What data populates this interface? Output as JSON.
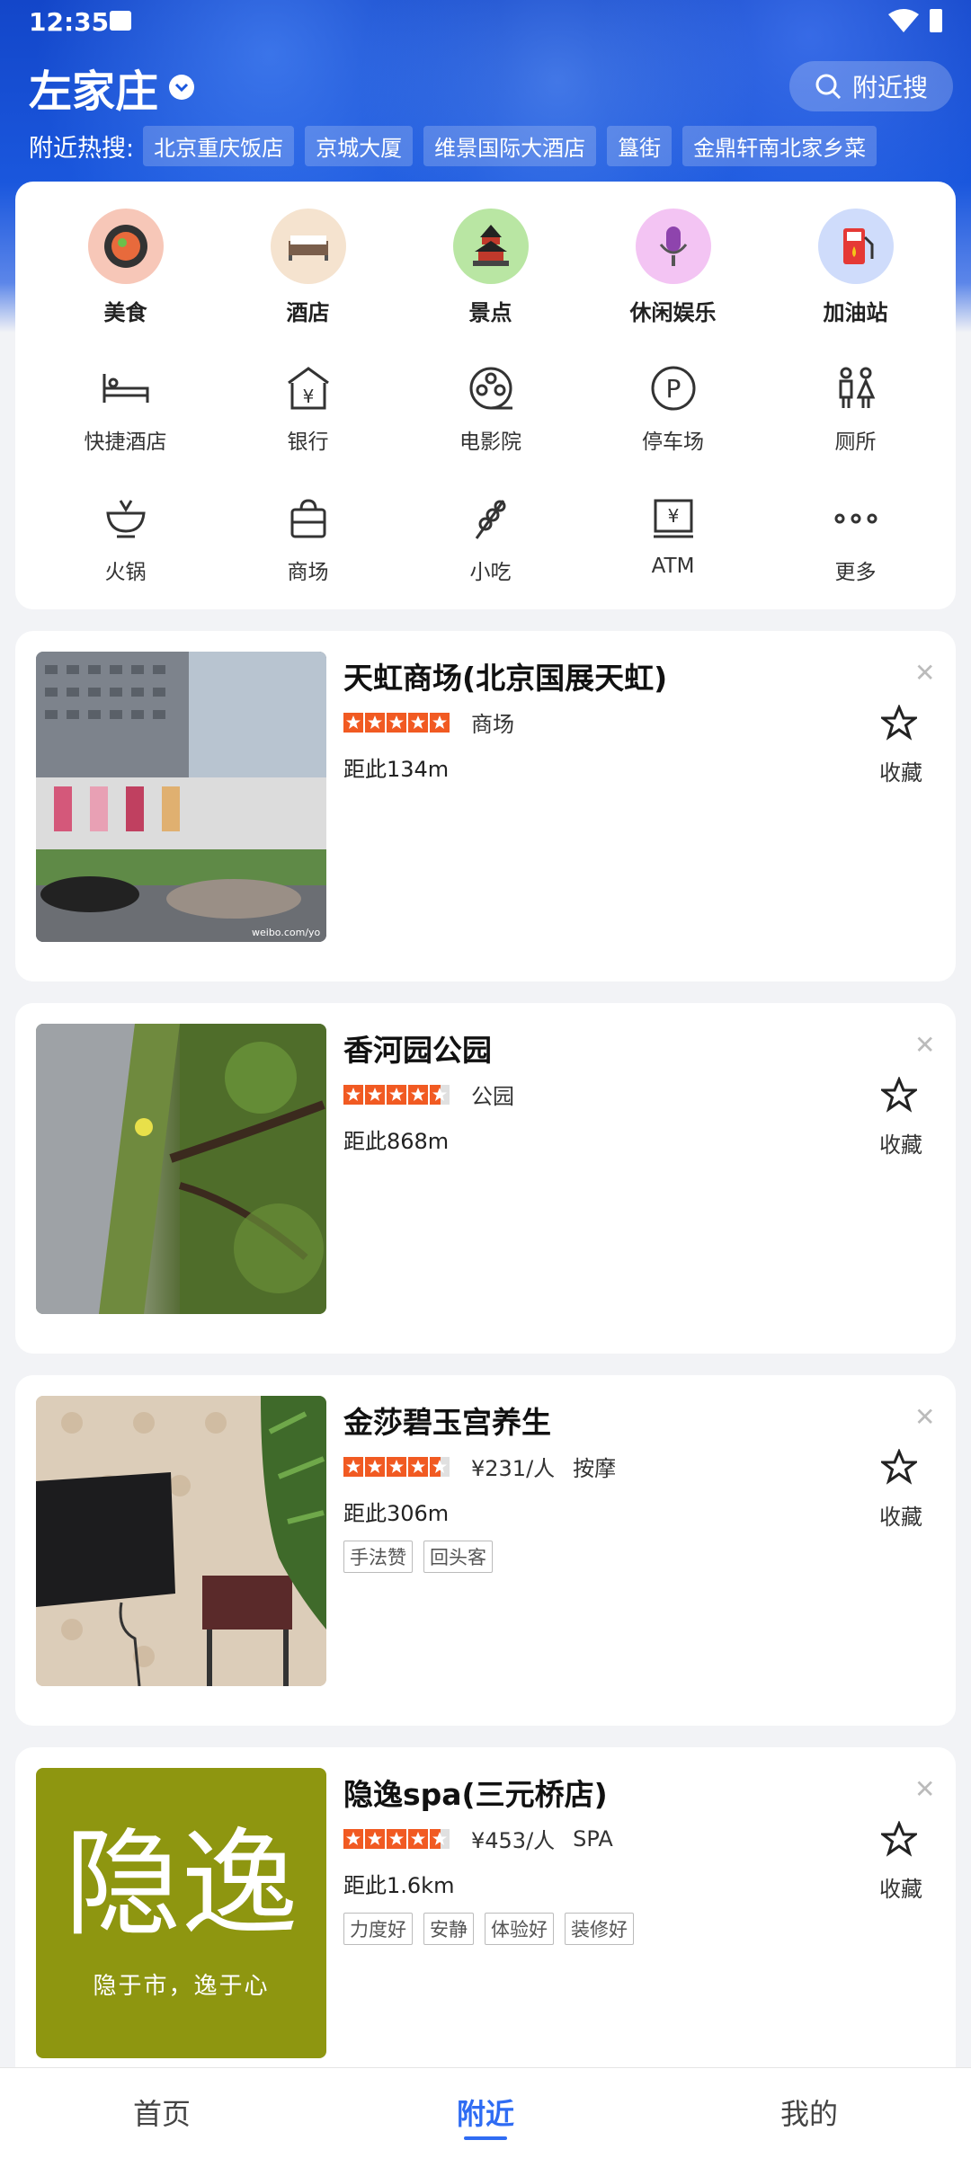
{
  "status_bar": {
    "time": "12:35"
  },
  "header": {
    "location": "左家庄",
    "nearby_search_label": "附近搜",
    "hot_search_label": "附近热搜:",
    "hot_search_items": [
      "北京重庆饭店",
      "京城大厦",
      "维景国际大酒店",
      "簋街",
      "金鼎轩南北家乡菜"
    ]
  },
  "categories_primary": [
    {
      "label": "美食",
      "icon": "food-icon"
    },
    {
      "label": "酒店",
      "icon": "hotel-icon"
    },
    {
      "label": "景点",
      "icon": "scenic-icon"
    },
    {
      "label": "休闲娱乐",
      "icon": "entertainment-icon"
    },
    {
      "label": "加油站",
      "icon": "gas-station-icon"
    }
  ],
  "categories_secondary": [
    {
      "label": "快捷酒店",
      "icon": "budget-hotel-icon"
    },
    {
      "label": "银行",
      "icon": "bank-icon"
    },
    {
      "label": "电影院",
      "icon": "cinema-icon"
    },
    {
      "label": "停车场",
      "icon": "parking-icon"
    },
    {
      "label": "厕所",
      "icon": "restroom-icon"
    },
    {
      "label": "火锅",
      "icon": "hotpot-icon"
    },
    {
      "label": "商场",
      "icon": "mall-icon"
    },
    {
      "label": "小吃",
      "icon": "snack-icon"
    },
    {
      "label": "ATM",
      "icon": "atm-icon"
    },
    {
      "label": "更多",
      "icon": "more-icon"
    }
  ],
  "pois": [
    {
      "name": "天虹商场(北京国展天虹)",
      "rating": 5,
      "price": "",
      "category": "商场",
      "distance": "距此134m",
      "tags": [],
      "fav_label": "收藏"
    },
    {
      "name": "香河园公园",
      "rating": 4.5,
      "price": "",
      "category": "公园",
      "distance": "距此868m",
      "tags": [],
      "fav_label": "收藏"
    },
    {
      "name": "金莎碧玉宫养生",
      "rating": 4.5,
      "price": "¥231/人",
      "category": "按摩",
      "distance": "距此306m",
      "tags": [
        "手法赞",
        "回头客"
      ],
      "fav_label": "收藏"
    },
    {
      "name": "隐逸spa(三元桥店)",
      "rating": 4.5,
      "price": "¥453/人",
      "category": "SPA",
      "distance": "距此1.6km",
      "tags": [
        "力度好",
        "安静",
        "体验好",
        "装修好"
      ],
      "fav_label": "收藏",
      "logo_text": "隐逸",
      "logo_slogan": "隐于市，逸于心"
    }
  ],
  "image_watermark": "weibo.com/yo",
  "bottom_nav": [
    {
      "label": "首页",
      "active": false
    },
    {
      "label": "附近",
      "active": true
    },
    {
      "label": "我的",
      "active": false
    }
  ],
  "colors": {
    "primary": "#2f6cf3",
    "header_blue": "#1a57dd",
    "star_orange": "#f15a22",
    "logo_olive": "#8e9610"
  }
}
